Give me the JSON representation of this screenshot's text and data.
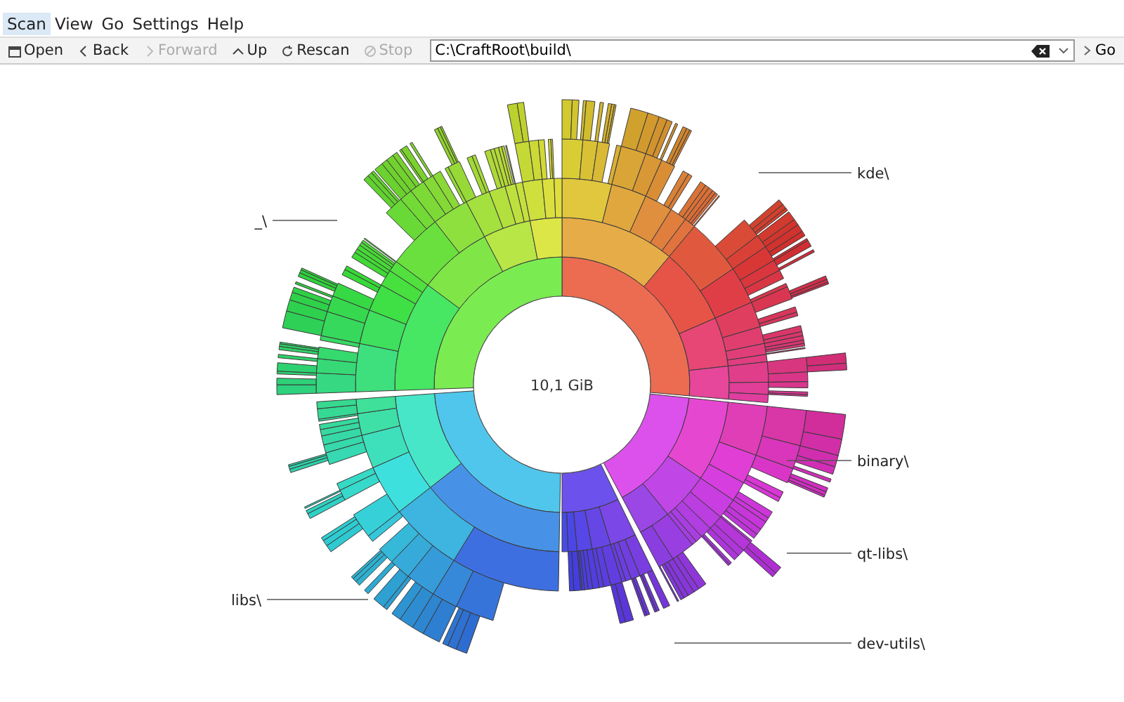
{
  "menu": [
    {
      "label": "Scan",
      "selected": true
    },
    {
      "label": "View",
      "selected": false
    },
    {
      "label": "Go",
      "selected": false
    },
    {
      "label": "Settings",
      "selected": false
    },
    {
      "label": "Help",
      "selected": false
    }
  ],
  "toolbar": [
    {
      "label": "Open",
      "disabled": false
    },
    {
      "label": "Back",
      "disabled": false
    },
    {
      "label": "Forward",
      "disabled": true
    },
    {
      "label": "Up",
      "disabled": false
    },
    {
      "label": "Rescan",
      "disabled": false
    },
    {
      "label": "Stop",
      "disabled": true
    }
  ],
  "address": {
    "value": "C:\\CraftRoot\\build\\",
    "go": "Go"
  },
  "sunburst": {
    "total": "10,1 GiB",
    "labels": [
      "kde\\",
      "_\\",
      "binary\\",
      "qt-libs\\",
      "libs\\",
      "dev-utils\\"
    ]
  }
}
